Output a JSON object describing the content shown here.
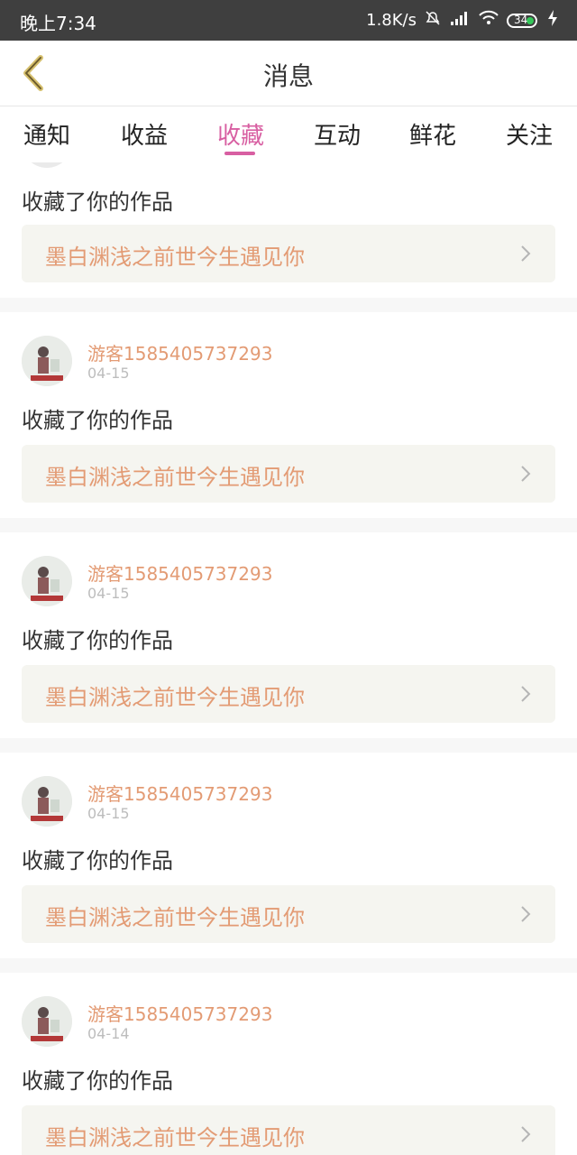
{
  "status_bar": {
    "time": "晚上7:34",
    "speed": "1.8K/s",
    "battery": "34"
  },
  "header": {
    "title": "消息",
    "back_icon": "chevron-left-icon"
  },
  "tabs": [
    {
      "label": "通知"
    },
    {
      "label": "收益"
    },
    {
      "label": "收藏",
      "active": true
    },
    {
      "label": "互动"
    },
    {
      "label": "鲜花"
    },
    {
      "label": "关注"
    }
  ],
  "items": [
    {
      "action": "收藏了你的作品",
      "work": "墨白渊浅之前世今生遇见你"
    },
    {
      "username": "游客1585405737293",
      "date": "04-15",
      "action": "收藏了你的作品",
      "work": "墨白渊浅之前世今生遇见你"
    },
    {
      "username": "游客1585405737293",
      "date": "04-15",
      "action": "收藏了你的作品",
      "work": "墨白渊浅之前世今生遇见你"
    },
    {
      "username": "游客1585405737293",
      "date": "04-15",
      "action": "收藏了你的作品",
      "work": "墨白渊浅之前世今生遇见你"
    },
    {
      "username": "游客1585405737293",
      "date": "04-14",
      "action": "收藏了你的作品",
      "work": "墨白渊浅之前世今生遇见你"
    }
  ],
  "colors": {
    "accent_pink": "#d85fa2",
    "username_orange": "#e39b74"
  }
}
